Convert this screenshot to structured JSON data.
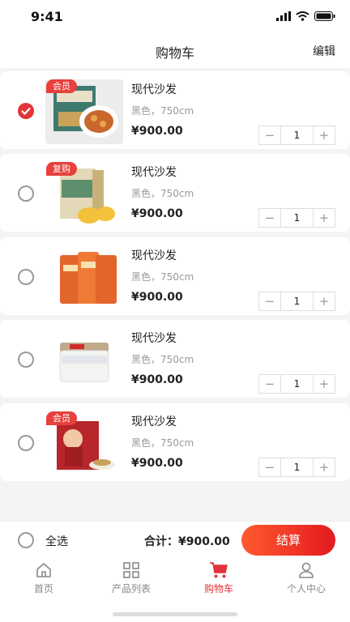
{
  "status": {
    "time": "9:41"
  },
  "nav": {
    "title": "购物车",
    "edit": "编辑"
  },
  "items": [
    {
      "name": "现代沙发",
      "spec": "黑色，750cm",
      "price": "¥900.00",
      "qty": "1",
      "badge": "会员",
      "checked": true,
      "image": "dumpling-box"
    },
    {
      "name": "现代沙发",
      "spec": "黑色，750cm",
      "price": "¥900.00",
      "qty": "1",
      "badge": "复购",
      "checked": false,
      "image": "spring-rolls-box"
    },
    {
      "name": "现代沙发",
      "spec": "黑色，750cm",
      "price": "¥900.00",
      "qty": "1",
      "badge": "",
      "checked": false,
      "image": "snack-bags"
    },
    {
      "name": "现代沙发",
      "spec": "黑色，750cm",
      "price": "¥900.00",
      "qty": "1",
      "badge": "",
      "checked": false,
      "image": "calcium-jar"
    },
    {
      "name": "现代沙发",
      "spec": "黑色，750cm",
      "price": "¥900.00",
      "qty": "1",
      "badge": "会员",
      "checked": false,
      "image": "tea-gift-box"
    }
  ],
  "checkout": {
    "select_all": "全选",
    "total": "合计：¥900.00",
    "pay": "结算"
  },
  "tabs": [
    {
      "label": "首页",
      "icon": "home-icon",
      "active": false
    },
    {
      "label": "产品列表",
      "icon": "grid-icon",
      "active": false
    },
    {
      "label": "购物车",
      "icon": "cart-icon",
      "active": true
    },
    {
      "label": "个人中心",
      "icon": "user-icon",
      "active": false
    }
  ],
  "colors": {
    "accent": "#e2343a",
    "badge": "#e8403c"
  }
}
